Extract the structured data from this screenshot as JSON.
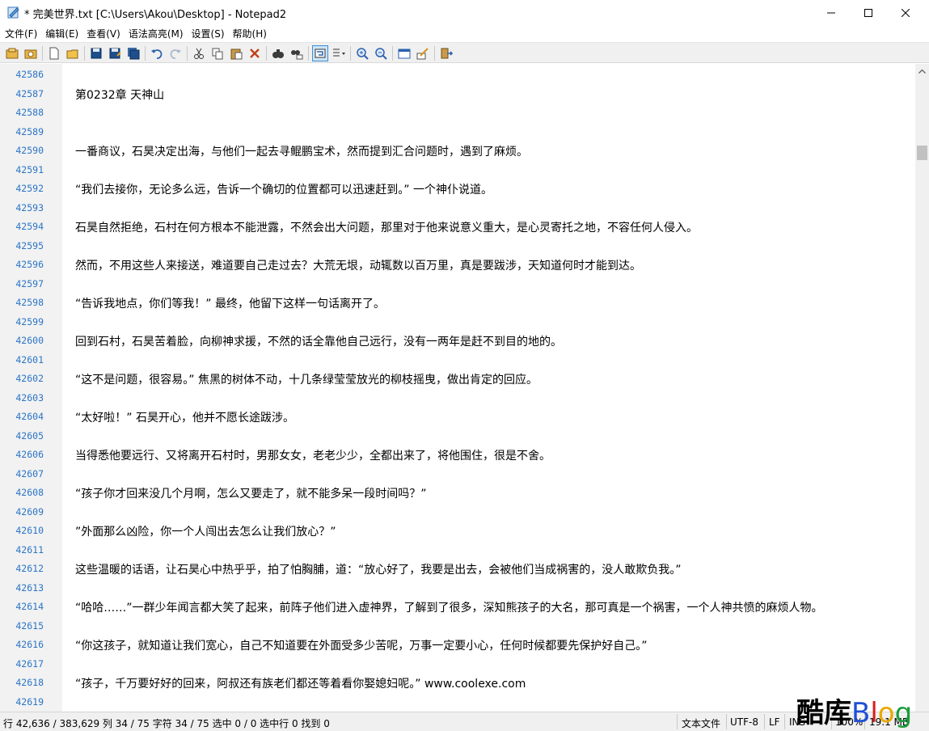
{
  "window": {
    "title": "* 完美世界.txt [C:\\Users\\Akou\\Desktop] - Notepad2",
    "controls": {
      "minimize": "minimize-icon",
      "maximize": "maximize-icon",
      "close": "close-icon"
    }
  },
  "menu": [
    {
      "id": "file",
      "label": "文件(F)"
    },
    {
      "id": "edit",
      "label": "编辑(E)"
    },
    {
      "id": "view",
      "label": "查看(V)"
    },
    {
      "id": "syntax",
      "label": "语法高亮(M)"
    },
    {
      "id": "settings",
      "label": "设置(S)"
    },
    {
      "id": "help",
      "label": "帮助(H)"
    }
  ],
  "toolbar": [
    {
      "icon": "browse-icon"
    },
    {
      "icon": "favorites-icon"
    },
    {
      "sep": true
    },
    {
      "icon": "new-file-icon"
    },
    {
      "icon": "open-file-icon"
    },
    {
      "sep": true
    },
    {
      "icon": "save-icon"
    },
    {
      "icon": "save-as-icon"
    },
    {
      "icon": "save-copy-icon"
    },
    {
      "sep": true
    },
    {
      "icon": "undo-icon"
    },
    {
      "icon": "redo-icon"
    },
    {
      "sep": true
    },
    {
      "icon": "cut-icon"
    },
    {
      "icon": "copy-icon"
    },
    {
      "icon": "paste-icon"
    },
    {
      "icon": "delete-icon"
    },
    {
      "sep": true
    },
    {
      "icon": "find-icon"
    },
    {
      "icon": "replace-icon"
    },
    {
      "sep": true
    },
    {
      "icon": "word-wrap-icon",
      "active": true
    },
    {
      "icon": "scheme-dropdown-icon"
    },
    {
      "sep": true
    },
    {
      "icon": "zoom-in-icon"
    },
    {
      "icon": "zoom-out-icon"
    },
    {
      "sep": true
    },
    {
      "icon": "scheme-config-icon"
    },
    {
      "icon": "customize-icon"
    },
    {
      "sep": true
    },
    {
      "icon": "exit-icon"
    }
  ],
  "editor": {
    "lines": [
      {
        "n": "42586",
        "text": ""
      },
      {
        "n": "42587",
        "text": "第0232章 天神山"
      },
      {
        "n": "42588",
        "text": ""
      },
      {
        "n": "42589",
        "text": ""
      },
      {
        "n": "42590",
        "text": "一番商议，石昊决定出海，与他们一起去寻鲲鹏宝术，然而提到汇合问题时，遇到了麻烦。"
      },
      {
        "n": "42591",
        "text": ""
      },
      {
        "n": "42592",
        "text": "“我们去接你，无论多么远，告诉一个确切的位置都可以迅速赶到。” 一个神仆说道。"
      },
      {
        "n": "42593",
        "text": ""
      },
      {
        "n": "42594",
        "text": "石昊自然拒绝，石村在何方根本不能泄露，不然会出大问题，那里对于他来说意义重大，是心灵寄托之地，不容任何人侵入。"
      },
      {
        "n": "42595",
        "text": ""
      },
      {
        "n": "42596",
        "text": "然而，不用这些人来接送，难道要自己走过去？大荒无垠，动辄数以百万里，真是要跋涉，天知道何时才能到达。"
      },
      {
        "n": "42597",
        "text": ""
      },
      {
        "n": "42598",
        "text": "“告诉我地点，你们等我！” 最终，他留下这样一句话离开了。"
      },
      {
        "n": "42599",
        "text": ""
      },
      {
        "n": "42600",
        "text": "回到石村，石昊苦着脸，向柳神求援，不然的话全靠他自己远行，没有一两年是赶不到目的地的。"
      },
      {
        "n": "42601",
        "text": ""
      },
      {
        "n": "42602",
        "text": "“这不是问题，很容易。” 焦黑的树体不动，十几条绿莹莹放光的柳枝摇曳，做出肯定的回应。"
      },
      {
        "n": "42603",
        "text": ""
      },
      {
        "n": "42604",
        "text": "“太好啦！” 石昊开心，他并不愿长途跋涉。"
      },
      {
        "n": "42605",
        "text": ""
      },
      {
        "n": "42606",
        "text": "当得悉他要远行、又将离开石村时，男那女女，老老少少，全都出来了，将他围住，很是不舍。"
      },
      {
        "n": "42607",
        "text": ""
      },
      {
        "n": "42608",
        "text": "“孩子你才回来没几个月啊，怎么又要走了，就不能多呆一段时间吗？”"
      },
      {
        "n": "42609",
        "text": ""
      },
      {
        "n": "42610",
        "text": "”外面那么凶险，你一个人闯出去怎么让我们放心？”"
      },
      {
        "n": "42611",
        "text": ""
      },
      {
        "n": "42612",
        "text": "这些温暖的话语，让石昊心中热乎乎，拍了怕胸脯，道：“放心好了，我要是出去，会被他们当成祸害的，没人敢欺负我。”"
      },
      {
        "n": "42613",
        "text": ""
      },
      {
        "n": "42614",
        "text": "“哈哈……”一群少年闻言都大笑了起来，前阵子他们进入虚神界，了解到了很多，深知熊孩子的大名，那可真是一个祸害，一个人神共愤的麻烦人物。"
      },
      {
        "n": "42615",
        "text": ""
      },
      {
        "n": "42616",
        "text": "“你这孩子，就知道让我们宽心，自己不知道要在外面受多少苦呢，万事一定要小心，任何时候都要先保护好自己。”"
      },
      {
        "n": "42617",
        "text": ""
      },
      {
        "n": "42618",
        "text": "“孩子，千万要好好的回来，阿叔还有族老们都还等着看你娶媳妇呢。” www.coolexe.com"
      },
      {
        "n": "42619",
        "text": ""
      }
    ]
  },
  "status": {
    "position": "行 42,636 / 383,629 列 34 / 75 字符 34 / 75 选中 0 / 0 选中行 0 找到 0",
    "file_type": "文本文件",
    "encoding": "UTF-8",
    "line_ending": "LF",
    "mode": "INS",
    "zoom": "100%",
    "size": "19.1 MB"
  },
  "watermark": {
    "cn": "酷库",
    "b": "B",
    "l": "l",
    "o": "o",
    "g": "g"
  },
  "colors": {
    "line_number": "#2a74c6",
    "gutter": "#f2f2f2",
    "active_tool": "#cce4f7"
  }
}
